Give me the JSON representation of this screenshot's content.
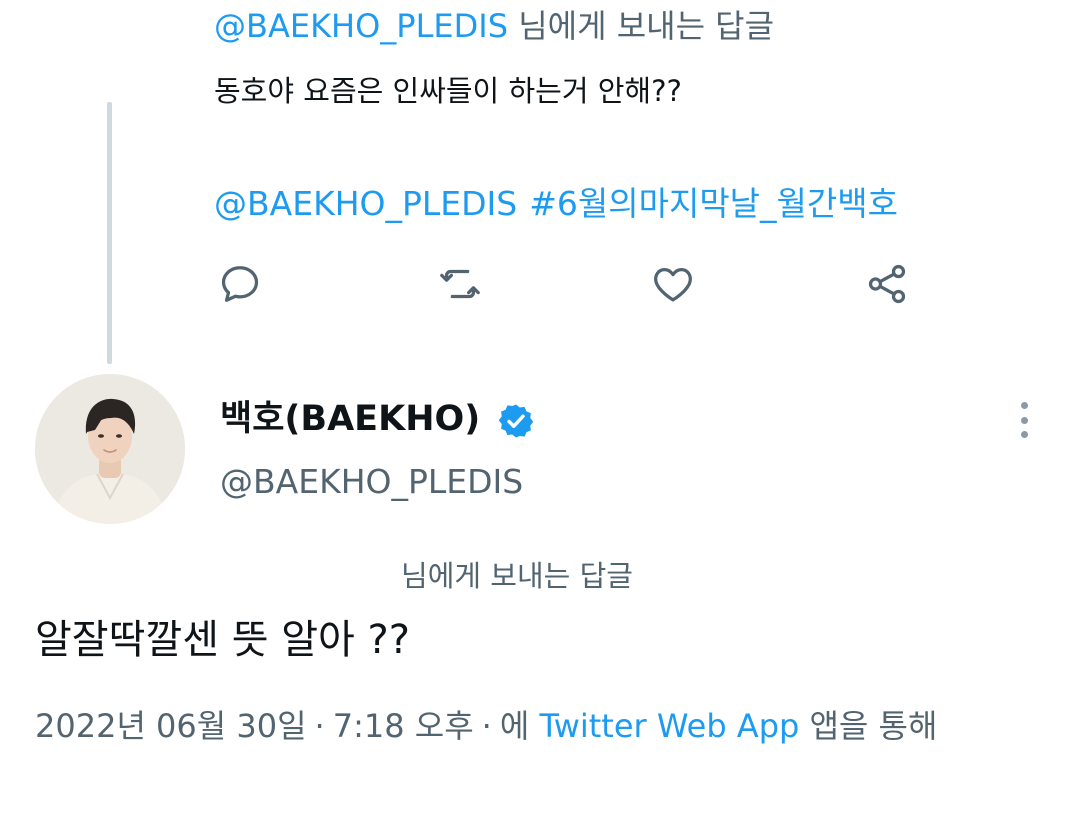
{
  "parent_tweet": {
    "replying_to_handle": "@BAEKHO_PLEDIS",
    "replying_to_suffix": "님에게 보내는 답글",
    "text": "동호야 요즘은 인싸들이 하는거 안해??",
    "mention": "@BAEKHO_PLEDIS",
    "hashtag": "#6월의마지막날_월간백호",
    "actions": {
      "reply_icon": "reply-bubble-icon",
      "retweet_icon": "retweet-icon",
      "like_icon": "heart-icon",
      "share_icon": "share-icon"
    }
  },
  "main_tweet": {
    "display_name": "백호(BAEKHO)",
    "verified_icon": "verified-badge-icon",
    "handle": "@BAEKHO_PLEDIS",
    "replying_to_text": "님에게 보내는 답글",
    "text": "알잘딱깔센 뜻 알아 ??",
    "meta": {
      "date": "2022년 06월 30일",
      "separator": "·",
      "time": "7:18 오후",
      "via_prefix": "에",
      "source": "Twitter Web App",
      "via_suffix": "앱을 통해"
    }
  },
  "colors": {
    "link": "#1d9bf0",
    "muted": "#536471",
    "text": "#0f1419",
    "thread_line": "#cfd9de",
    "verified": "#1d9bf0"
  }
}
